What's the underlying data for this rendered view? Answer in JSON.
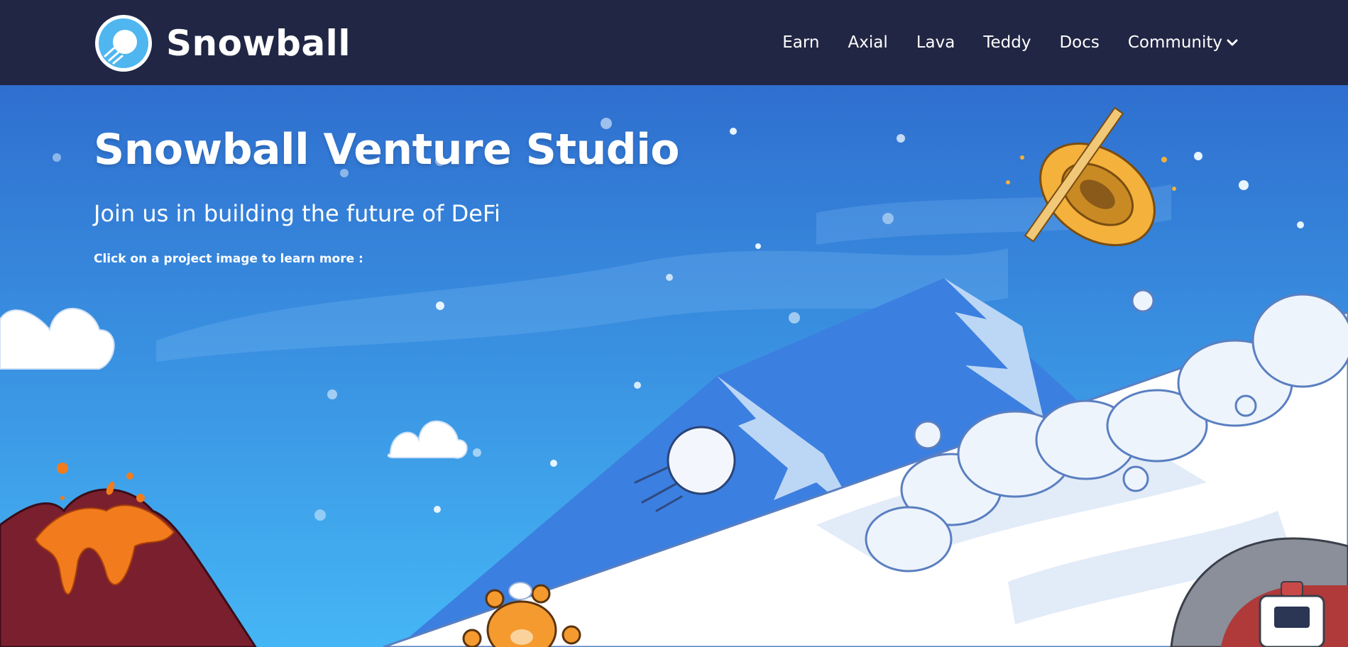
{
  "header": {
    "brand_name": "Snowball",
    "logo_icon": "snowball-logo-icon",
    "nav_items": [
      {
        "label": "Earn"
      },
      {
        "label": "Axial"
      },
      {
        "label": "Lava"
      },
      {
        "label": "Teddy"
      },
      {
        "label": "Docs"
      },
      {
        "label": "Community",
        "icon": "chevron-down-icon"
      }
    ]
  },
  "hero": {
    "title": "Snowball Venture Studio",
    "subtitle": "Join us in building the future of DeFi",
    "hint": "Click on a project image to learn more :"
  },
  "scene_projects": [
    {
      "name": "axial",
      "icon": "axial-ring-icon"
    },
    {
      "name": "lava",
      "icon": "volcano-icon"
    },
    {
      "name": "teddy",
      "icon": "teddy-bear-icon"
    },
    {
      "name": "tunnel",
      "icon": "tunnel-robot-icon"
    }
  ],
  "colors": {
    "nav_bg": "#212644",
    "sky_top": "#2f6fcf",
    "sky_bottom": "#45b6f5",
    "snow": "#ffffff",
    "text": "#ffffff"
  }
}
